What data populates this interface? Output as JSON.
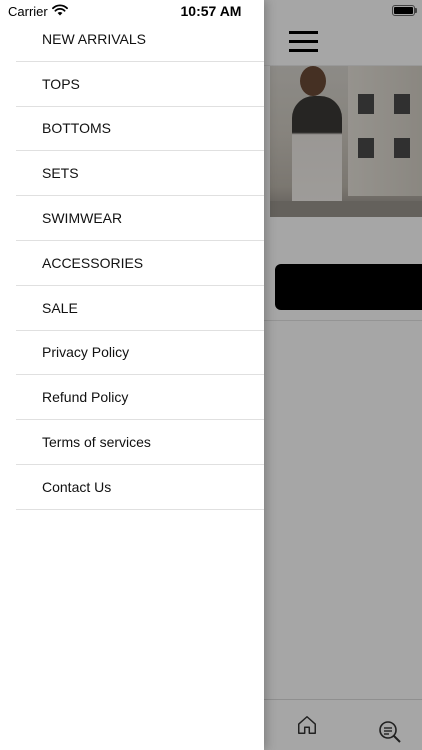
{
  "status_bar": {
    "carrier": "Carrier",
    "time": "10:57 AM",
    "wifi_icon": "wifi-icon",
    "battery_icon": "battery-icon"
  },
  "side_menu": {
    "items": [
      {
        "label": "NEW ARRIVALS"
      },
      {
        "label": "TOPS"
      },
      {
        "label": "BOTTOMS"
      },
      {
        "label": "SETS"
      },
      {
        "label": "SWIMWEAR"
      },
      {
        "label": "ACCESSORIES"
      },
      {
        "label": "SALE"
      },
      {
        "label": "Privacy Policy"
      },
      {
        "label": "Refund Policy"
      },
      {
        "label": "Terms of services"
      },
      {
        "label": "Contact Us"
      }
    ]
  },
  "header": {
    "menu_icon": "hamburger-menu-icon"
  },
  "tab_bar": {
    "items": [
      {
        "icon": "home-icon"
      },
      {
        "icon": "search-icon"
      }
    ]
  },
  "colors": {
    "background": "#ffffff",
    "text": "#111111",
    "divider": "#e0e0e0",
    "button": "#000000",
    "overlay": "rgba(0,0,0,0.35)"
  }
}
